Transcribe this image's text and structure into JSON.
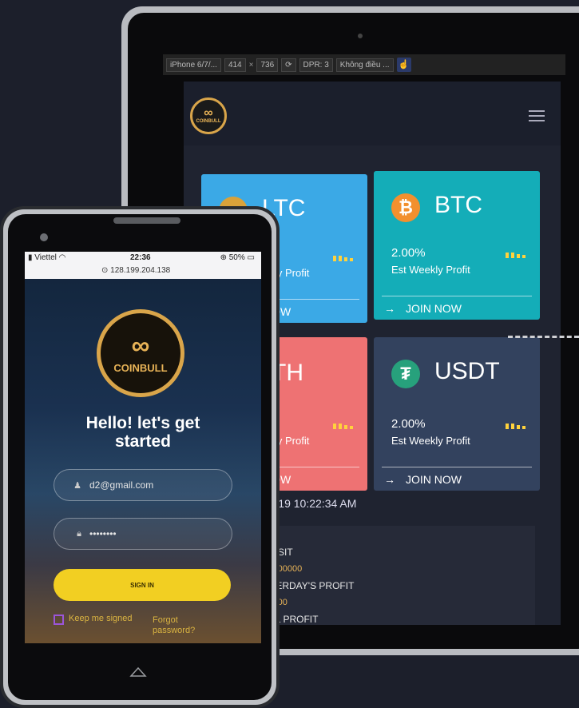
{
  "devtools": {
    "device": "iPhone 6/7/...",
    "width": "414",
    "times": "×",
    "height": "736",
    "rotate_icon": "rotate-icon",
    "dpr": "DPR: 3",
    "throttle": "Không điều ...",
    "touch_icon": "touch-icon"
  },
  "desktop": {
    "logo_text": "COINBULL",
    "menu_icon": "hamburger-icon",
    "cards": [
      {
        "symbol": "LTC",
        "rate": "",
        "label": "ly Profit",
        "join": "NOW",
        "color": "#3ba9e6"
      },
      {
        "symbol": "BTC",
        "rate": "2.00%",
        "label": "Est Weekly Profit",
        "join": "JOIN NOW",
        "color": "#14adb8"
      },
      {
        "symbol": "ETH",
        "rate": "",
        "label": "ly Profit",
        "join": "NOW",
        "color": "#ee7273"
      },
      {
        "symbol": "USDT",
        "rate": "2.00%",
        "label": "Est Weekly Profit",
        "join": "JOIN NOW",
        "color": "#33425e"
      }
    ],
    "updated": "ed on  June 7, 2019 10:22:34 AM",
    "stats": [
      {
        "key": "DEPOSIT",
        "value": "1000.000000"
      },
      {
        "key": "YESTERDAY'S PROFIT",
        "value": "0.000000"
      },
      {
        "key": "TOTAL PROFIT",
        "value": ""
      }
    ]
  },
  "mobile": {
    "status": {
      "carrier": "Viettel",
      "time": "22:36",
      "battery": "50%",
      "url": "128.199.204.138"
    },
    "logo_text": "COINBULL",
    "headline_line1": "Hello! let's get",
    "headline_line2": "started",
    "email_value": "d2@gmail.com",
    "password_value": "••••••••",
    "signin_label": "SIGN IN",
    "remember_label": "Keep me signed",
    "forgot_label": "Forgot password?"
  }
}
